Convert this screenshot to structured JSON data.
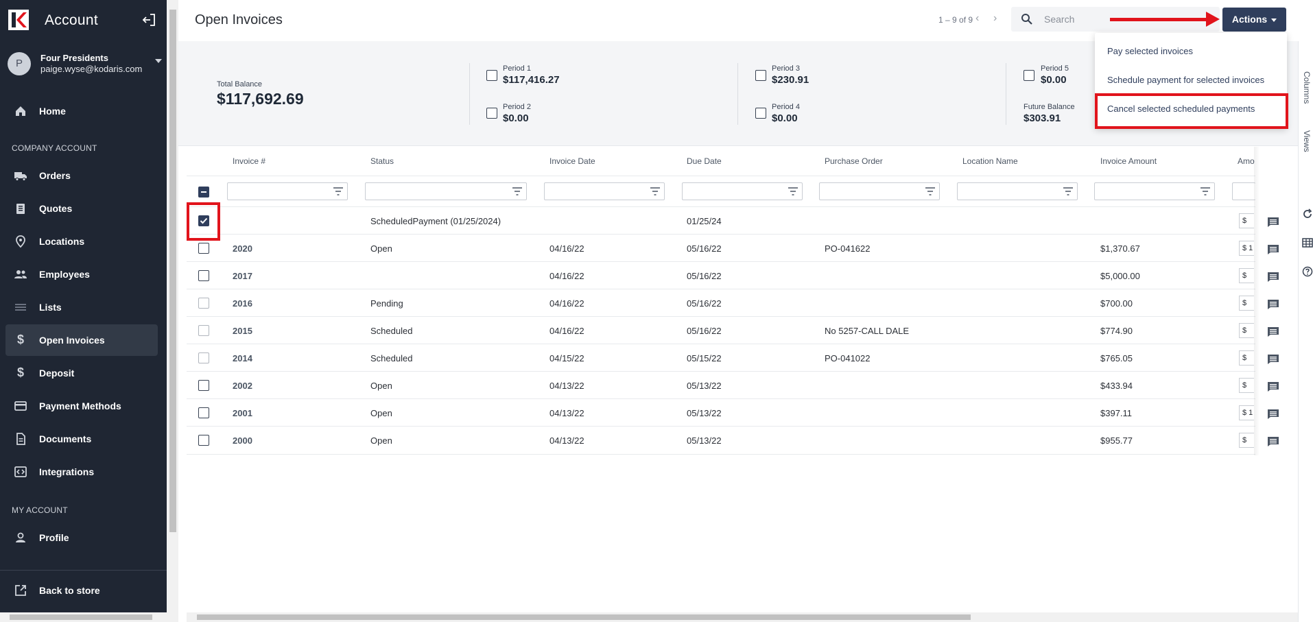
{
  "sidebar": {
    "app_title": "Account",
    "account": {
      "initial": "P",
      "name": "Four Presidents",
      "email": "paige.wyse@kodaris.com"
    },
    "sections": {
      "company": "COMPANY ACCOUNT",
      "my_account": "MY ACCOUNT"
    },
    "items": [
      {
        "label": "Home",
        "icon": "home-icon"
      },
      {
        "label": "Orders",
        "icon": "truck-icon"
      },
      {
        "label": "Quotes",
        "icon": "clipboard-icon"
      },
      {
        "label": "Locations",
        "icon": "map-pin-icon"
      },
      {
        "label": "Employees",
        "icon": "people-icon"
      },
      {
        "label": "Lists",
        "icon": "list-icon"
      },
      {
        "label": "Open Invoices",
        "icon": "dollar-icon",
        "active": true
      },
      {
        "label": "Deposit",
        "icon": "dollar-icon"
      },
      {
        "label": "Payment Methods",
        "icon": "credit-card-icon"
      },
      {
        "label": "Documents",
        "icon": "document-icon"
      },
      {
        "label": "Integrations",
        "icon": "integration-icon"
      },
      {
        "label": "Profile",
        "icon": "person-icon"
      }
    ],
    "footer": {
      "label": "Back to store",
      "icon": "external-link-icon"
    }
  },
  "header": {
    "title": "Open Invoices",
    "pager": "1 – 9 of 9",
    "search": {
      "placeholder": "Search",
      "value": ""
    },
    "actions_label": "Actions"
  },
  "actions_menu": {
    "items": [
      "Pay selected invoices",
      "Schedule payment for selected invoices",
      "Cancel selected scheduled payments"
    ],
    "highlighted_index": 2
  },
  "summary": {
    "total_balance_label": "Total Balance",
    "total_balance": "$117,692.69",
    "periods": [
      {
        "label": "Period 1",
        "value": "$117,416.27"
      },
      {
        "label": "Period 2",
        "value": "$0.00"
      },
      {
        "label": "Period 3",
        "value": "$230.91"
      },
      {
        "label": "Period 4",
        "value": "$0.00"
      },
      {
        "label": "Period 5",
        "value": "$0.00"
      }
    ],
    "future_balance_label": "Future Balance",
    "future_balance": "$303.91"
  },
  "right_rail": {
    "columns_label": "Columns",
    "views_label": "Views"
  },
  "grid": {
    "columns": [
      "Invoice #",
      "Status",
      "Invoice Date",
      "Due Date",
      "Purchase Order",
      "Location Name",
      "Invoice Amount",
      "Amo"
    ],
    "rows": [
      {
        "invoice": "",
        "status": "ScheduledPayment (01/25/2024)",
        "invoice_date": "",
        "due_date": "01/25/24",
        "po": "",
        "location": "",
        "amount": "",
        "amt_input": "$",
        "checked": true
      },
      {
        "invoice": "2020",
        "status": "Open",
        "invoice_date": "04/16/22",
        "due_date": "05/16/22",
        "po": "PO-041622",
        "location": "",
        "amount": "$1,370.67",
        "amt_input": "$ 1",
        "checked": false
      },
      {
        "invoice": "2017",
        "status": "",
        "invoice_date": "04/16/22",
        "due_date": "05/16/22",
        "po": "",
        "location": "",
        "amount": "$5,000.00",
        "amt_input": "$",
        "checked": false
      },
      {
        "invoice": "2016",
        "status": "Pending",
        "invoice_date": "04/16/22",
        "due_date": "05/16/22",
        "po": "",
        "location": "",
        "amount": "$700.00",
        "amt_input": "$",
        "checked": false,
        "light": true
      },
      {
        "invoice": "2015",
        "status": "Scheduled",
        "invoice_date": "04/16/22",
        "due_date": "05/16/22",
        "po": "No 5257-CALL DALE",
        "location": "",
        "amount": "$774.90",
        "amt_input": "$",
        "checked": false,
        "light": true
      },
      {
        "invoice": "2014",
        "status": "Scheduled",
        "invoice_date": "04/15/22",
        "due_date": "05/15/22",
        "po": "PO-041022",
        "location": "",
        "amount": "$765.05",
        "amt_input": "$",
        "checked": false,
        "light": true
      },
      {
        "invoice": "2002",
        "status": "Open",
        "invoice_date": "04/13/22",
        "due_date": "05/13/22",
        "po": "",
        "location": "",
        "amount": "$433.94",
        "amt_input": "$",
        "checked": false
      },
      {
        "invoice": "2001",
        "status": "Open",
        "invoice_date": "04/13/22",
        "due_date": "05/13/22",
        "po": "",
        "location": "",
        "amount": "$397.11",
        "amt_input": "$ 1",
        "checked": false
      },
      {
        "invoice": "2000",
        "status": "Open",
        "invoice_date": "04/13/22",
        "due_date": "05/13/22",
        "po": "",
        "location": "",
        "amount": "$955.77",
        "amt_input": "$",
        "checked": false
      }
    ]
  },
  "colors": {
    "sidebar_bg": "#1f2633",
    "accent": "#2f3e5c",
    "highlight_red": "#e1141c"
  }
}
